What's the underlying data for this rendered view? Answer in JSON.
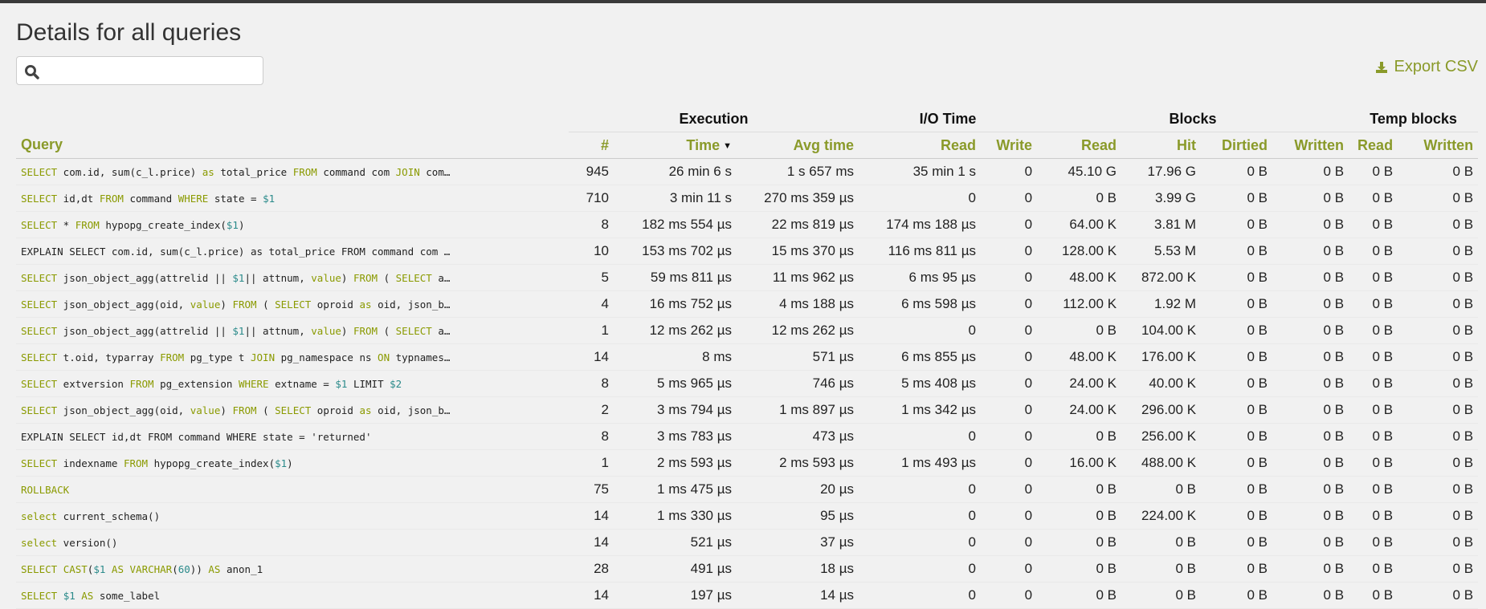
{
  "page": {
    "title": "Details for all queries",
    "search_placeholder": "",
    "export_label": "Export CSV"
  },
  "colors": {
    "accent": "#8a9a2a",
    "keyword": "#8a9a00",
    "param": "#2a8a8a"
  },
  "icons": {
    "search": "search-icon",
    "export": "download-icon",
    "sort": "sort-desc-caret-icon"
  },
  "groups": [
    "Execution",
    "I/O Time",
    "Blocks",
    "Temp blocks"
  ],
  "columns": [
    "Query",
    "#",
    "Time",
    "Avg time",
    "Read",
    "Write",
    "Read",
    "Hit",
    "Dirtied",
    "Written",
    "Read",
    "Written"
  ],
  "rows": [
    {
      "q": [
        [
          "k",
          "SELECT"
        ],
        [
          "t",
          " com.id, sum(c_l.price) "
        ],
        [
          "k",
          "as"
        ],
        [
          "t",
          " total_price "
        ],
        [
          "k",
          "FROM"
        ],
        [
          "t",
          " command com "
        ],
        [
          "k",
          "JOIN"
        ],
        [
          "t",
          " com…"
        ]
      ],
      "cells": [
        "945",
        "26 min 6 s",
        "1 s 657 ms",
        "35 min 1 s",
        "0",
        "45.10 G",
        "17.96 G",
        "0 B",
        "0 B",
        "0 B",
        "0 B"
      ]
    },
    {
      "q": [
        [
          "k",
          "SELECT"
        ],
        [
          "t",
          " id,dt "
        ],
        [
          "k",
          "FROM"
        ],
        [
          "t",
          " command "
        ],
        [
          "k",
          "WHERE"
        ],
        [
          "t",
          " state = "
        ],
        [
          "n",
          "$1"
        ]
      ],
      "cells": [
        "710",
        "3 min 11 s",
        "270 ms 359 µs",
        "0",
        "0",
        "0 B",
        "3.99 G",
        "0 B",
        "0 B",
        "0 B",
        "0 B"
      ]
    },
    {
      "q": [
        [
          "k",
          "SELECT"
        ],
        [
          "t",
          " *  "
        ],
        [
          "k",
          "FROM"
        ],
        [
          "t",
          " hypopg_create_index("
        ],
        [
          "n",
          "$1"
        ],
        [
          "t",
          ")"
        ]
      ],
      "cells": [
        "8",
        "182 ms 554 µs",
        "22 ms 819 µs",
        "174 ms 188 µs",
        "0",
        "64.00 K",
        "3.81 M",
        "0 B",
        "0 B",
        "0 B",
        "0 B"
      ]
    },
    {
      "q": [
        [
          "t",
          "EXPLAIN SELECT com.id, sum(c_l.price) as total_price FROM command com …"
        ]
      ],
      "cells": [
        "10",
        "153 ms 702 µs",
        "15 ms 370 µs",
        "116 ms 811 µs",
        "0",
        "128.00 K",
        "5.53 M",
        "0 B",
        "0 B",
        "0 B",
        "0 B"
      ]
    },
    {
      "q": [
        [
          "k",
          "SELECT"
        ],
        [
          "t",
          " json_object_agg(attrelid || "
        ],
        [
          "n",
          "$1"
        ],
        [
          "t",
          "|| attnum, "
        ],
        [
          "k",
          "value"
        ],
        [
          "t",
          ") "
        ],
        [
          "k",
          "FROM"
        ],
        [
          "t",
          " ( "
        ],
        [
          "k",
          "SELECT"
        ],
        [
          "t",
          " a…"
        ]
      ],
      "cells": [
        "5",
        "59 ms 811 µs",
        "11 ms 962 µs",
        "6 ms 95 µs",
        "0",
        "48.00 K",
        "872.00 K",
        "0 B",
        "0 B",
        "0 B",
        "0 B"
      ]
    },
    {
      "q": [
        [
          "k",
          "SELECT"
        ],
        [
          "t",
          " json_object_agg(oid, "
        ],
        [
          "k",
          "value"
        ],
        [
          "t",
          ") "
        ],
        [
          "k",
          "FROM"
        ],
        [
          "t",
          " ( "
        ],
        [
          "k",
          "SELECT"
        ],
        [
          "t",
          " oproid "
        ],
        [
          "k",
          "as"
        ],
        [
          "t",
          " oid, json_b…"
        ]
      ],
      "cells": [
        "4",
        "16 ms 752 µs",
        "4 ms 188 µs",
        "6 ms 598 µs",
        "0",
        "112.00 K",
        "1.92 M",
        "0 B",
        "0 B",
        "0 B",
        "0 B"
      ]
    },
    {
      "q": [
        [
          "k",
          "SELECT"
        ],
        [
          "t",
          " json_object_agg(attrelid || "
        ],
        [
          "n",
          "$1"
        ],
        [
          "t",
          "|| attnum, "
        ],
        [
          "k",
          "value"
        ],
        [
          "t",
          ") "
        ],
        [
          "k",
          "FROM"
        ],
        [
          "t",
          " ( "
        ],
        [
          "k",
          "SELECT"
        ],
        [
          "t",
          " a…"
        ]
      ],
      "cells": [
        "1",
        "12 ms 262 µs",
        "12 ms 262 µs",
        "0",
        "0",
        "0 B",
        "104.00 K",
        "0 B",
        "0 B",
        "0 B",
        "0 B"
      ]
    },
    {
      "q": [
        [
          "k",
          "SELECT"
        ],
        [
          "t",
          " t.oid, typarray "
        ],
        [
          "k",
          "FROM"
        ],
        [
          "t",
          " pg_type t "
        ],
        [
          "k",
          "JOIN"
        ],
        [
          "t",
          " pg_namespace ns "
        ],
        [
          "k",
          "ON"
        ],
        [
          "t",
          " typnames…"
        ]
      ],
      "cells": [
        "14",
        "8 ms",
        "571 µs",
        "6 ms 855 µs",
        "0",
        "48.00 K",
        "176.00 K",
        "0 B",
        "0 B",
        "0 B",
        "0 B"
      ]
    },
    {
      "q": [
        [
          "k",
          "SELECT"
        ],
        [
          "t",
          " extversion "
        ],
        [
          "k",
          "FROM"
        ],
        [
          "t",
          " pg_extension "
        ],
        [
          "k",
          "WHERE"
        ],
        [
          "t",
          " extname = "
        ],
        [
          "n",
          "$1"
        ],
        [
          "t",
          " LIMIT "
        ],
        [
          "n",
          "$2"
        ]
      ],
      "cells": [
        "8",
        "5 ms 965 µs",
        "746 µs",
        "5 ms 408 µs",
        "0",
        "24.00 K",
        "40.00 K",
        "0 B",
        "0 B",
        "0 B",
        "0 B"
      ]
    },
    {
      "q": [
        [
          "k",
          "SELECT"
        ],
        [
          "t",
          " json_object_agg(oid, "
        ],
        [
          "k",
          "value"
        ],
        [
          "t",
          ") "
        ],
        [
          "k",
          "FROM"
        ],
        [
          "t",
          " ( "
        ],
        [
          "k",
          "SELECT"
        ],
        [
          "t",
          " oproid "
        ],
        [
          "k",
          "as"
        ],
        [
          "t",
          " oid, json_b…"
        ]
      ],
      "cells": [
        "2",
        "3 ms 794 µs",
        "1 ms 897 µs",
        "1 ms 342 µs",
        "0",
        "24.00 K",
        "296.00 K",
        "0 B",
        "0 B",
        "0 B",
        "0 B"
      ]
    },
    {
      "q": [
        [
          "t",
          "EXPLAIN SELECT id,dt FROM command WHERE state = 'returned'"
        ]
      ],
      "cells": [
        "8",
        "3 ms 783 µs",
        "473 µs",
        "0",
        "0",
        "0 B",
        "256.00 K",
        "0 B",
        "0 B",
        "0 B",
        "0 B"
      ]
    },
    {
      "q": [
        [
          "k",
          "SELECT"
        ],
        [
          "t",
          " indexname  "
        ],
        [
          "k",
          "FROM"
        ],
        [
          "t",
          " hypopg_create_index("
        ],
        [
          "n",
          "$1"
        ],
        [
          "t",
          ")"
        ]
      ],
      "cells": [
        "1",
        "2 ms 593 µs",
        "2 ms 593 µs",
        "1 ms 493 µs",
        "0",
        "16.00 K",
        "488.00 K",
        "0 B",
        "0 B",
        "0 B",
        "0 B"
      ]
    },
    {
      "q": [
        [
          "k",
          "ROLLBACK"
        ]
      ],
      "cells": [
        "75",
        "1 ms 475 µs",
        "20 µs",
        "0",
        "0",
        "0 B",
        "0 B",
        "0 B",
        "0 B",
        "0 B",
        "0 B"
      ]
    },
    {
      "q": [
        [
          "k",
          "select"
        ],
        [
          "t",
          " current_schema()"
        ]
      ],
      "cells": [
        "14",
        "1 ms 330 µs",
        "95 µs",
        "0",
        "0",
        "0 B",
        "224.00 K",
        "0 B",
        "0 B",
        "0 B",
        "0 B"
      ]
    },
    {
      "q": [
        [
          "k",
          "select"
        ],
        [
          "t",
          " version()"
        ]
      ],
      "cells": [
        "14",
        "521 µs",
        "37 µs",
        "0",
        "0",
        "0 B",
        "0 B",
        "0 B",
        "0 B",
        "0 B",
        "0 B"
      ]
    },
    {
      "q": [
        [
          "k",
          "SELECT"
        ],
        [
          "t",
          " "
        ],
        [
          "k",
          "CAST"
        ],
        [
          "t",
          "("
        ],
        [
          "n",
          "$1"
        ],
        [
          "t",
          " "
        ],
        [
          "k",
          "AS"
        ],
        [
          "t",
          " "
        ],
        [
          "k",
          "VARCHAR"
        ],
        [
          "t",
          "("
        ],
        [
          "n",
          "60"
        ],
        [
          "t",
          ")) "
        ],
        [
          "k",
          "AS"
        ],
        [
          "t",
          " anon_1"
        ]
      ],
      "cells": [
        "28",
        "491 µs",
        "18 µs",
        "0",
        "0",
        "0 B",
        "0 B",
        "0 B",
        "0 B",
        "0 B",
        "0 B"
      ]
    },
    {
      "q": [
        [
          "k",
          "SELECT"
        ],
        [
          "t",
          " "
        ],
        [
          "n",
          "$1"
        ],
        [
          "t",
          " "
        ],
        [
          "k",
          "AS"
        ],
        [
          "t",
          " some_label"
        ]
      ],
      "cells": [
        "14",
        "197 µs",
        "14 µs",
        "0",
        "0",
        "0 B",
        "0 B",
        "0 B",
        "0 B",
        "0 B",
        "0 B"
      ]
    }
  ]
}
